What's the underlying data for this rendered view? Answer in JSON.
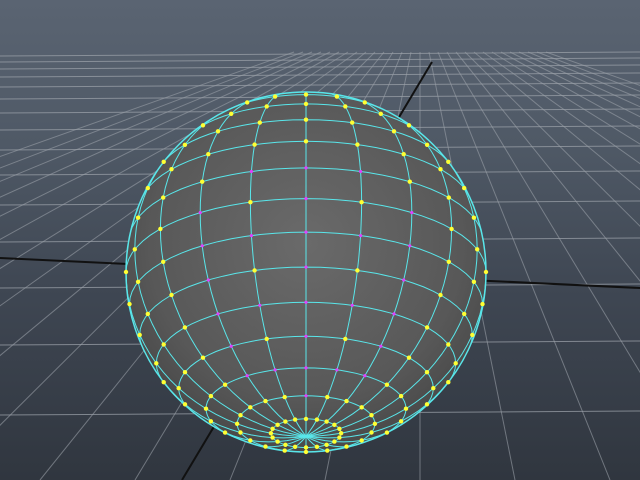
{
  "viewport": {
    "name": "perspective-viewport",
    "colors": {
      "background_top": "#5a6472",
      "background_bottom": "#30363f",
      "grid_line": "#9aa0a8",
      "grid_axis": "#111111",
      "sphere_fill": "#5b5b5b",
      "wireframe": "#59e6ea",
      "component_vertex": "#ffff33",
      "component_vertex_hidden": "#e040ff"
    }
  },
  "scene": {
    "grid": {
      "visible": true
    },
    "object": {
      "type": "poly-sphere",
      "display": "wireframe-on-shaded",
      "selected": true,
      "component_mode": "vertex"
    }
  }
}
